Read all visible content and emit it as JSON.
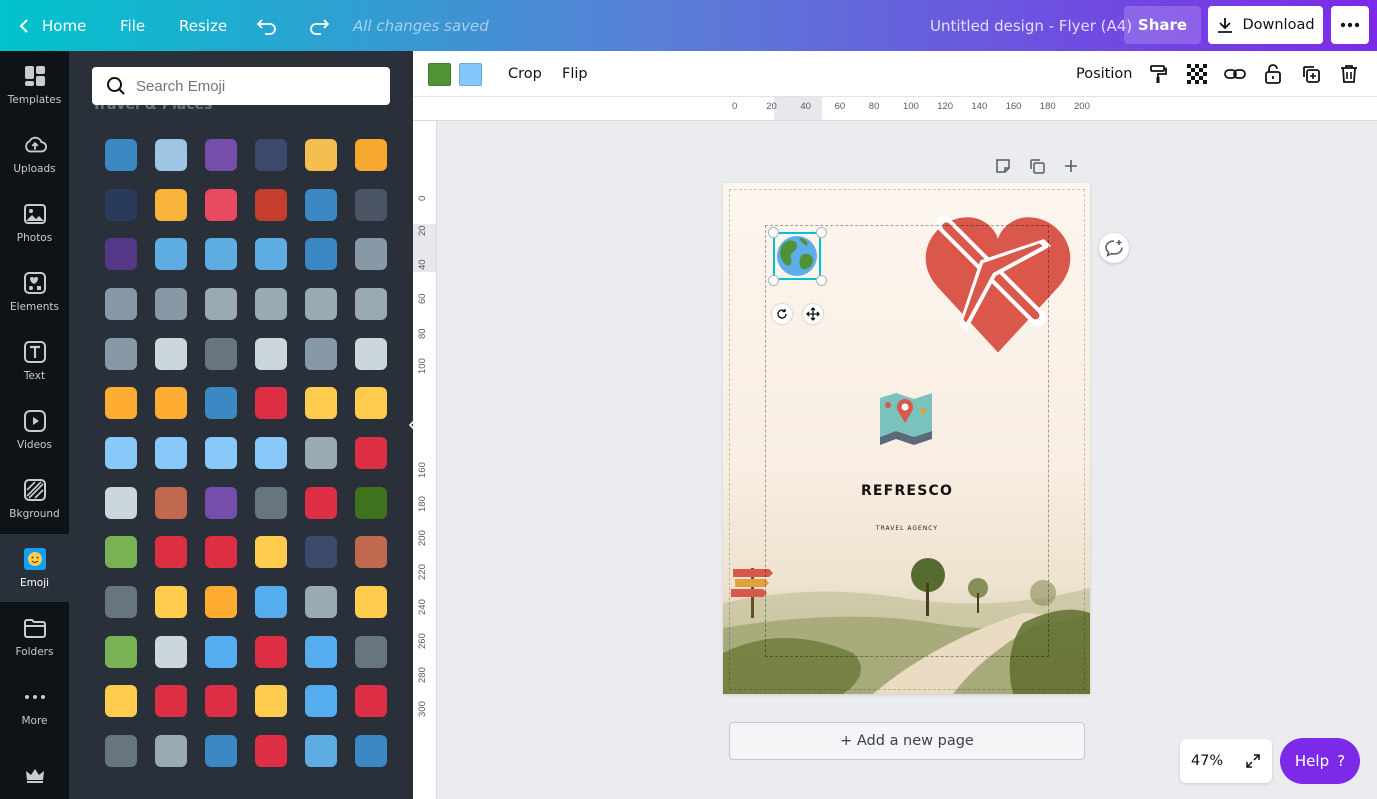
{
  "topbar": {
    "home": "Home",
    "file": "File",
    "resize": "Resize",
    "saved_status": "All changes saved",
    "design_title": "Untitled design - Flyer (A4)",
    "share": "Share",
    "download": "Download"
  },
  "rail": {
    "items": [
      {
        "label": "Templates",
        "icon": "templates-icon"
      },
      {
        "label": "Uploads",
        "icon": "cloud-upload-icon"
      },
      {
        "label": "Photos",
        "icon": "photo-icon"
      },
      {
        "label": "Elements",
        "icon": "shapes-icon"
      },
      {
        "label": "Text",
        "icon": "text-icon"
      },
      {
        "label": "Videos",
        "icon": "video-icon"
      },
      {
        "label": "Bkground",
        "icon": "background-icon"
      },
      {
        "label": "Emoji",
        "icon": "emoji-icon"
      },
      {
        "label": "Folders",
        "icon": "folder-icon"
      },
      {
        "label": "More",
        "icon": "more-dots-icon"
      }
    ],
    "active": "Emoji"
  },
  "panel": {
    "search_placeholder": "Search Emoji",
    "section_title": "Travel & Places",
    "emoji_colors": [
      "#3b88c3",
      "#9fc4e4",
      "#744eaa",
      "#3b4a6b",
      "#f4bf4f",
      "#f7a831",
      "#2a3a5a",
      "#f7b33a",
      "#e84a5f",
      "#c43d2f",
      "#3b88c3",
      "#4b5563",
      "#553788",
      "#5dade2",
      "#5dade2",
      "#5dade2",
      "#3b88c3",
      "#8899a6",
      "#8899a6",
      "#8899a6",
      "#99aab5",
      "#99aab5",
      "#99aab5",
      "#99aab5",
      "#8899a6",
      "#ccd6dd",
      "#66757f",
      "#ccd6dd",
      "#8899a6",
      "#ccd6dd",
      "#ffac33",
      "#ffac33",
      "#3b88c3",
      "#dd2e44",
      "#ffcc4d",
      "#ffcc4d",
      "#88c9f9",
      "#88c9f9",
      "#88c9f9",
      "#88c9f9",
      "#99aab5",
      "#dd2e44",
      "#ccd6dd",
      "#c1694f",
      "#744eaa",
      "#66757f",
      "#dd2e44",
      "#3e721d",
      "#77b255",
      "#dd2e44",
      "#dd2e44",
      "#ffcc4d",
      "#3b4a6b",
      "#c1694f",
      "#66757f",
      "#ffcc4d",
      "#ffac33",
      "#55acee",
      "#99aab5",
      "#ffcc4d",
      "#77b255",
      "#ccd6dd",
      "#55acee",
      "#dd2e44",
      "#55acee",
      "#66757f",
      "#ffcc4d",
      "#dd2e44",
      "#dd2e44",
      "#ffcc4d",
      "#55acee",
      "#dd2e44",
      "#66757f",
      "#99aab5",
      "#3b88c3",
      "#dd2e44",
      "#5dade2",
      "#3b88c3"
    ]
  },
  "toolbar": {
    "color1": "#4f9336",
    "color2": "#84c7fa",
    "crop": "Crop",
    "flip": "Flip",
    "position": "Position"
  },
  "ruler": {
    "h_ticks": [
      "0",
      "20",
      "40",
      "60",
      "80",
      "100",
      "120",
      "140",
      "160",
      "180",
      "200"
    ],
    "v_ticks": [
      "0",
      "20",
      "40",
      "60",
      "80",
      "100",
      "160",
      "180",
      "200",
      "220",
      "240",
      "260",
      "280",
      "300"
    ]
  },
  "canvas": {
    "brand": "REFRESCO",
    "tagline": "TRAVEL AGENCY",
    "heart_color": "#d9574b",
    "add_page": "+ Add a new page"
  },
  "footer": {
    "zoom": "47%",
    "help": "Help",
    "help_icon": "?"
  }
}
